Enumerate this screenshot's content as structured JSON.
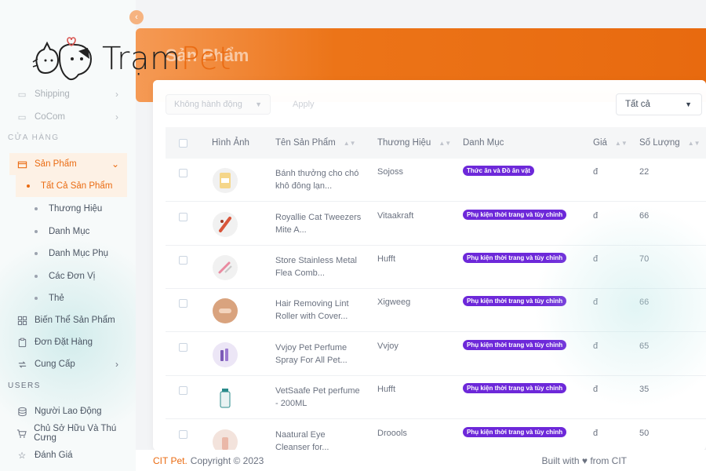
{
  "brand": {
    "logo_part1": "Trạm",
    "logo_part2": "Pet"
  },
  "page": {
    "title": "Sản Phẩm"
  },
  "sidebar": {
    "faded_items": [
      {
        "label": "Shipping",
        "icon": "truck-icon"
      },
      {
        "label": "CoCom",
        "icon": "box-icon"
      }
    ],
    "section_store": "CỬA HÀNG",
    "products": {
      "label": "Sản Phẩm",
      "subitems": [
        "Tất Cả Sản Phẩm",
        "Thương Hiệu",
        "Danh Mục",
        "Danh Mục Phụ",
        "Các Đơn Vị",
        "Thẻ"
      ]
    },
    "items": [
      {
        "label": "Biến Thể Sản Phẩm",
        "icon": "grid-icon"
      },
      {
        "label": "Đơn Đặt Hàng",
        "icon": "clipboard-icon"
      },
      {
        "label": "Cung Cấp",
        "icon": "supply-icon"
      }
    ],
    "section_users": "USERS",
    "user_items": [
      {
        "label": "Người Lao Động",
        "icon": "database-icon"
      },
      {
        "label": "Chủ Sở Hữu Và Thú Cưng",
        "icon": "cart-icon"
      },
      {
        "label": "Đánh Giá",
        "icon": "star-icon"
      }
    ]
  },
  "toolbar": {
    "bulk_action": "Không hành động",
    "apply": "Apply",
    "filter": "Tất cả"
  },
  "table": {
    "columns": [
      "Hình Ảnh",
      "Tên Sản Phẩm",
      "Thương Hiệu",
      "Danh Mục",
      "Giá",
      "Số Lượng"
    ],
    "rows": [
      {
        "name": "Bánh thưởng cho chó khô đông lạn...",
        "brand": "Sojoss",
        "category": "Thức ăn và Đồ ăn vặt",
        "price": "đ",
        "qty": "22"
      },
      {
        "name": "Royallie Cat Tweezers Mite A...",
        "brand": "Vitaakraft",
        "category": "Phụ kiện thời trang và tùy chỉnh",
        "price": "đ",
        "qty": "66"
      },
      {
        "name": "Store Stainless Metal Flea Comb...",
        "brand": "Hufft",
        "category": "Phụ kiện thời trang và tùy chỉnh",
        "price": "đ",
        "qty": "70"
      },
      {
        "name": "Hair Removing Lint Roller with Cover...",
        "brand": "Xigweeg",
        "category": "Phụ kiện thời trang và tùy chỉnh",
        "price": "đ",
        "qty": "66"
      },
      {
        "name": "Vvjoy Pet Perfume Spray For All Pet...",
        "brand": "Vvjoy",
        "category": "Phụ kiện thời trang và tùy chỉnh",
        "price": "đ",
        "qty": "65"
      },
      {
        "name": "VetSaafe Pet perfume - 200ML",
        "brand": "Hufft",
        "category": "Phụ kiện thời trang và tùy chỉnh",
        "price": "đ",
        "qty": "35"
      },
      {
        "name": "Naatural Eye Cleanser for...",
        "brand": "Droools",
        "category": "Phụ kiện thời trang và tùy chỉnh",
        "price": "đ",
        "qty": "50"
      }
    ]
  },
  "footer": {
    "brand": "CIT Pet.",
    "copyright": "Copyright © 2023",
    "built": "Built with ♥ from CIT"
  },
  "colors": {
    "accent": "#ea6b12",
    "badge": "#6d28d9"
  }
}
